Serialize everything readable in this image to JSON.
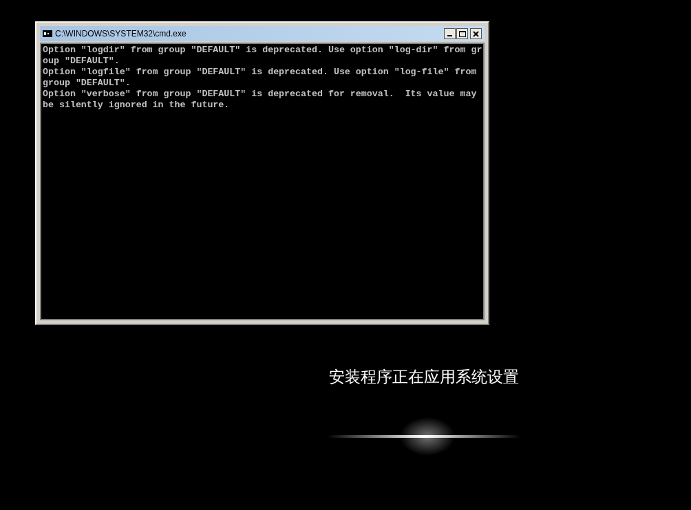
{
  "window": {
    "title": "C:\\WINDOWS\\SYSTEM32\\cmd.exe"
  },
  "console_lines": [
    "Option \"logdir\" from group \"DEFAULT\" is deprecated. Use option \"log-dir\" from gr",
    "oup \"DEFAULT\".",
    "Option \"logfile\" from group \"DEFAULT\" is deprecated. Use option \"log-file\" from",
    "group \"DEFAULT\".",
    "Option \"verbose\" from group \"DEFAULT\" is deprecated for removal.  Its value may",
    "be silently ignored in the future."
  ],
  "setup_status": "安装程序正在应用系统设置"
}
